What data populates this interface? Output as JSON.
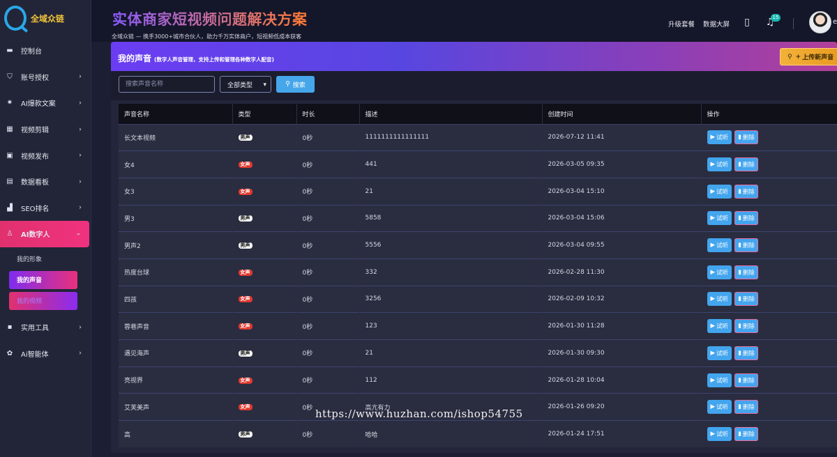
{
  "brand": {
    "name": "全域众链"
  },
  "header": {
    "title": "实体商家短视频问题解决方案",
    "subtitle": "全域众链 — 携手3000+城市合伙人，助力千万实体商户，短视频低成本获客",
    "upgrade": "升级套餐",
    "dashboard": "数据大屏",
    "badge": "15",
    "avatar_text": "e"
  },
  "sidebar": {
    "items": [
      {
        "label": "控制台",
        "icon": "monitor-icon"
      },
      {
        "label": "账号授权",
        "icon": "shield-icon"
      },
      {
        "label": "AI爆款文案",
        "icon": "bulb-icon"
      },
      {
        "label": "视频剪辑",
        "icon": "film-icon"
      },
      {
        "label": "视频发布",
        "icon": "upload-icon"
      },
      {
        "label": "数据看板",
        "icon": "chart-icon"
      },
      {
        "label": "SEO排名",
        "icon": "bars-icon"
      },
      {
        "label": "AI数字人",
        "icon": "user-icon"
      },
      {
        "label": "实用工具",
        "icon": "toolbox-icon"
      },
      {
        "label": "Ai智能体",
        "icon": "robot-icon"
      }
    ],
    "sub": [
      "我的形象",
      "我的声音",
      "我的视频"
    ]
  },
  "panel": {
    "title": "我的声音",
    "note": "(数字人声音管理，支持上传和管理各种数字人配音)",
    "upload": "上传新声音"
  },
  "filter": {
    "search_placeholder": "搜索声音名称",
    "type_selected": "全部类型",
    "search_label": "搜索"
  },
  "table": {
    "headers": [
      "声音名称",
      "类型",
      "时长",
      "描述",
      "创建时间",
      "操作"
    ],
    "play_label": "试听",
    "delete_label": "删除",
    "rows": [
      {
        "name": "长文本视频",
        "type": "男声",
        "gender": "male",
        "duration": "0秒",
        "desc": "1111111111111111",
        "created": "2026-07-12 11:41"
      },
      {
        "name": "女4",
        "type": "女声",
        "gender": "female",
        "duration": "0秒",
        "desc": "441",
        "created": "2026-03-05 09:35"
      },
      {
        "name": "女3",
        "type": "女声",
        "gender": "female",
        "duration": "0秒",
        "desc": "21",
        "created": "2026-03-04 15:10"
      },
      {
        "name": "男3",
        "type": "男声",
        "gender": "male",
        "duration": "0秒",
        "desc": "5858",
        "created": "2026-03-04 15:06"
      },
      {
        "name": "男声2",
        "type": "男声",
        "gender": "male",
        "duration": "0秒",
        "desc": "5556",
        "created": "2026-03-04 09:55"
      },
      {
        "name": "热度台球",
        "type": "女声",
        "gender": "female",
        "duration": "0秒",
        "desc": "332",
        "created": "2026-02-28 11:30"
      },
      {
        "name": "四孩",
        "type": "女声",
        "gender": "female",
        "duration": "0秒",
        "desc": "3256",
        "created": "2026-02-09 10:32"
      },
      {
        "name": "蓉巷声音",
        "type": "女声",
        "gender": "female",
        "duration": "0秒",
        "desc": "123",
        "created": "2026-01-30 11:28"
      },
      {
        "name": "遇见海声",
        "type": "男声",
        "gender": "male",
        "duration": "0秒",
        "desc": "21",
        "created": "2026-01-30 09:30"
      },
      {
        "name": "亮视界",
        "type": "女声",
        "gender": "female",
        "duration": "0秒",
        "desc": "112",
        "created": "2026-01-28 10:04"
      },
      {
        "name": "艾芙美声",
        "type": "女声",
        "gender": "female",
        "duration": "0秒",
        "desc": "高亢有力",
        "created": "2026-01-26 09:20"
      },
      {
        "name": "高",
        "type": "男声",
        "gender": "male",
        "duration": "0秒",
        "desc": "哈哈",
        "created": "2026-01-24 17:51"
      }
    ]
  },
  "watermark": "https://www.huzhan.com/ishop54755"
}
